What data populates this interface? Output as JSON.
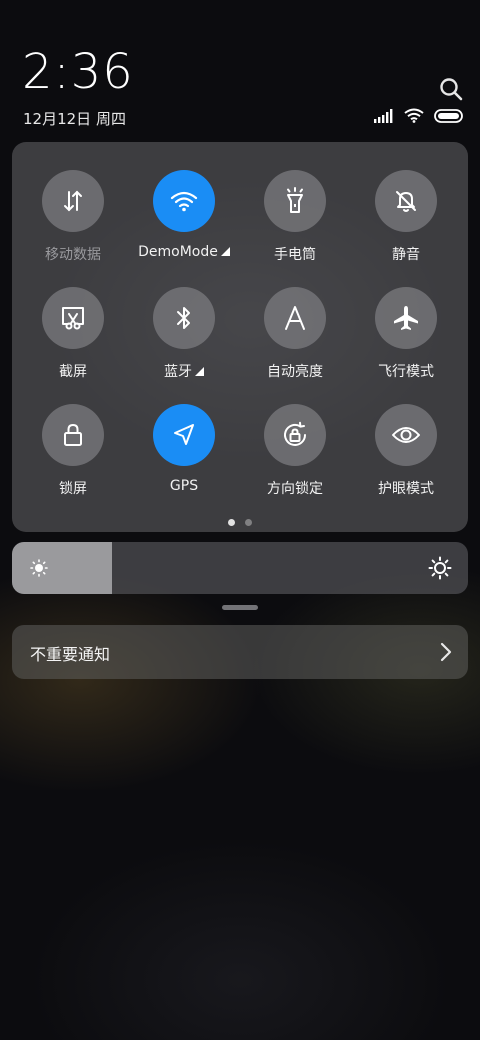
{
  "header": {
    "time": "2:36",
    "date": "12月12日 周四"
  },
  "icons": {
    "search": "search-icon",
    "signal": "signal-bars-icon",
    "wifi_status": "wifi-icon",
    "battery": "battery-icon"
  },
  "colors": {
    "active_tile": "#1a8df5",
    "inactive_tile": "#78787c",
    "panel": "#5c5c60"
  },
  "quick_settings": {
    "tiles": [
      {
        "label": "移动数据",
        "icon": "mobile-data-icon",
        "active": false,
        "dim": true
      },
      {
        "label": "DemoMode",
        "icon": "wifi-icon",
        "active": true,
        "has_menu": true
      },
      {
        "label": "手电筒",
        "icon": "flashlight-icon",
        "active": false
      },
      {
        "label": "静音",
        "icon": "bell-off-icon",
        "active": false
      },
      {
        "label": "截屏",
        "icon": "screenshot-icon",
        "active": false
      },
      {
        "label": "蓝牙",
        "icon": "bluetooth-icon",
        "active": false,
        "has_menu": true
      },
      {
        "label": "自动亮度",
        "icon": "auto-brightness-icon",
        "active": false
      },
      {
        "label": "飞行模式",
        "icon": "airplane-icon",
        "active": false
      },
      {
        "label": "锁屏",
        "icon": "lock-icon",
        "active": false
      },
      {
        "label": "GPS",
        "icon": "location-arrow-icon",
        "active": true
      },
      {
        "label": "方向锁定",
        "icon": "rotation-lock-icon",
        "active": false
      },
      {
        "label": "护眼模式",
        "icon": "eye-icon",
        "active": false
      }
    ],
    "page_count": 2,
    "current_page": 1
  },
  "brightness": {
    "level": 0.22
  },
  "notifications": {
    "unimportant_label": "不重要通知"
  }
}
